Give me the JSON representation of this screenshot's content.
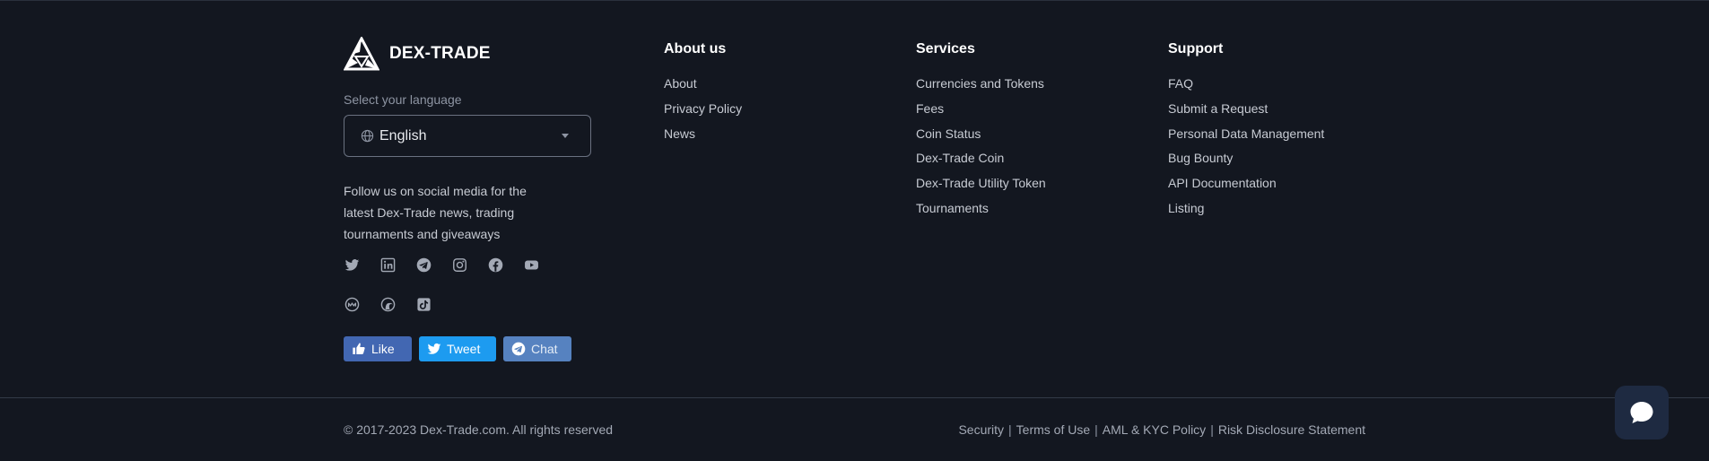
{
  "brand": {
    "name": "DEX-TRADE"
  },
  "language": {
    "label": "Select your language",
    "selected": "English"
  },
  "social": {
    "text": "Follow us on social media for the latest Dex-Trade news, trading tournaments and giveaways",
    "row1": [
      "twitter-icon",
      "linkedin-icon",
      "telegram-icon",
      "instagram-icon",
      "facebook-icon",
      "youtube-icon"
    ],
    "row2": [
      "coinmarketcap-icon",
      "coingecko-icon",
      "tiktok-icon"
    ]
  },
  "share": {
    "like": "Like",
    "tweet": "Tweet",
    "chat": "Chat",
    "colors": {
      "like": "#4267b2",
      "tweet": "#1d9bf0",
      "chat": "#5682c0"
    }
  },
  "columns": [
    {
      "title": "About us",
      "links": [
        "About",
        "Privacy Policy",
        "News"
      ]
    },
    {
      "title": "Services",
      "links": [
        "Currencies and Tokens",
        "Fees",
        "Coin Status",
        "Dex-Trade Coin",
        "Dex-Trade Utility Token",
        "Tournaments"
      ]
    },
    {
      "title": "Support",
      "links": [
        "FAQ",
        "Submit a Request",
        "Personal Data Management",
        "Bug Bounty",
        "API Documentation",
        "Listing"
      ]
    }
  ],
  "bottom": {
    "copyright": "© 2017-2023 Dex-Trade.com. All rights reserved",
    "legal": [
      "Security",
      "Terms of Use",
      "AML & KYC Policy",
      "Risk Disclosure Statement"
    ],
    "separator": "|"
  },
  "chat_widget": {
    "icon": "chat-bubble-icon"
  },
  "theme": {
    "background": "#131720",
    "chat_widget": "#1e2a41"
  }
}
